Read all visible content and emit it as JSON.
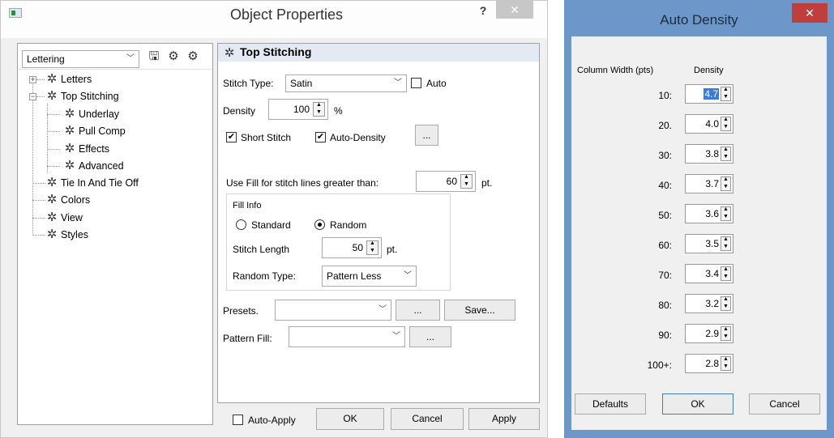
{
  "object_properties": {
    "title": "Object Properties",
    "help_label": "?",
    "close_label": "✕",
    "tree": {
      "category": "Lettering",
      "items": [
        "Letters",
        "Top Stitching",
        "Underlay",
        "Pull Comp",
        "Effects",
        "Advanced",
        "Tie In And Tie Off",
        "Colors",
        "View",
        "Styles"
      ]
    },
    "panel": {
      "header": "Top Stitching",
      "stitch_type_label": "Stitch Type:",
      "stitch_type_value": "Satin",
      "auto_label": "Auto",
      "density_label": "Density",
      "density_value": "100",
      "density_unit": "%",
      "short_stitch_label": "Short Stitch",
      "auto_density_label": "Auto-Density",
      "ellipsis": "...",
      "use_fill_label": "Use Fill for stitch lines greater than:",
      "use_fill_value": "60",
      "pt_unit": "pt.",
      "fill_info_label": "Fill Info",
      "standard_label": "Standard",
      "random_label": "Random",
      "stitch_length_label": "Stitch Length",
      "stitch_length_value": "50",
      "random_type_label": "Random Type:",
      "random_type_value": "Pattern Less",
      "presets_label": "Presets.",
      "save_label": "Save...",
      "pattern_fill_label": "Pattern Fill:"
    },
    "footer": {
      "auto_apply_label": "Auto-Apply",
      "ok_label": "OK",
      "cancel_label": "Cancel",
      "apply_label": "Apply"
    }
  },
  "auto_density": {
    "title": "Auto Density",
    "close_label": "✕",
    "col_width_header": "Column Width (pts)",
    "density_header": "Density",
    "rows": [
      {
        "width": "10:",
        "density": "4.7"
      },
      {
        "width": "20.",
        "density": "4.0"
      },
      {
        "width": "30:",
        "density": "3.8"
      },
      {
        "width": "40:",
        "density": "3.7"
      },
      {
        "width": "50:",
        "density": "3.6"
      },
      {
        "width": "60:",
        "density": "3.5"
      },
      {
        "width": "70:",
        "density": "3.4"
      },
      {
        "width": "80:",
        "density": "3.2"
      },
      {
        "width": "90:",
        "density": "2.9"
      },
      {
        "width": "100+:",
        "density": "2.8"
      }
    ],
    "defaults_label": "Defaults",
    "ok_label": "OK",
    "cancel_label": "Cancel"
  }
}
